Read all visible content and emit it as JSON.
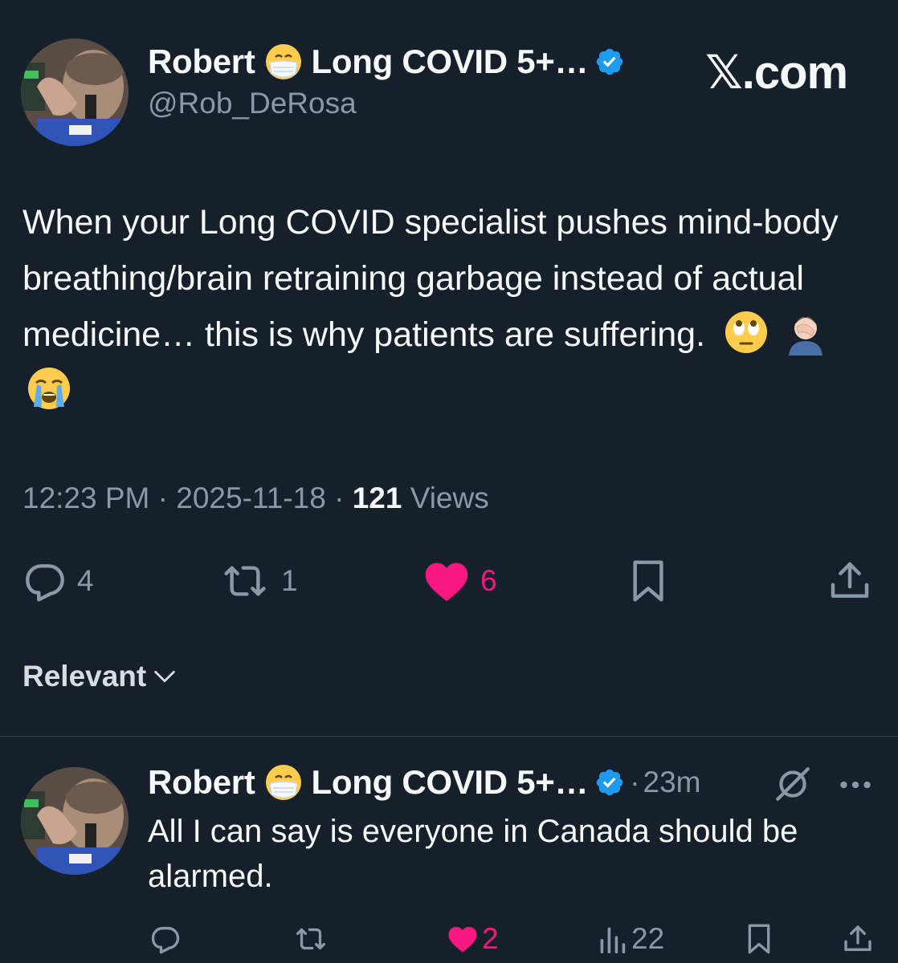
{
  "post": {
    "author_name": "Robert",
    "author_name_suffix": "Long COVID 5+…",
    "handle": "@Rob_DeRosa",
    "text": "When your Long COVID specialist pushes mind-body breathing/brain retraining garbage instead of actual medicine… this is why patients are suffering.",
    "emojis": [
      "face-with-rolling-eyes",
      "person-facepalming",
      "loudly-crying-face"
    ],
    "time": "12:23 PM",
    "date": "2025-11-18",
    "views_count": "121",
    "views_label": "Views",
    "separator": "·",
    "actions": {
      "replies": "4",
      "reposts": "1",
      "likes": "6"
    }
  },
  "brand": {
    "logo_text": "𝕏.com"
  },
  "sort": {
    "label": "Relevant"
  },
  "reply": {
    "author_name": "Robert",
    "author_name_suffix": "Long COVID 5+…",
    "time_ago": "23m",
    "separator": "·",
    "text": "All I can say is everyone in Canada should be alarmed.",
    "actions": {
      "likes": "2",
      "views": "22"
    }
  },
  "colors": {
    "background": "#15202b",
    "text": "#f7f9f9",
    "secondary": "#8b98a5",
    "like": "#f91880",
    "verified": "#1d9bf0",
    "divider": "#38444d"
  }
}
